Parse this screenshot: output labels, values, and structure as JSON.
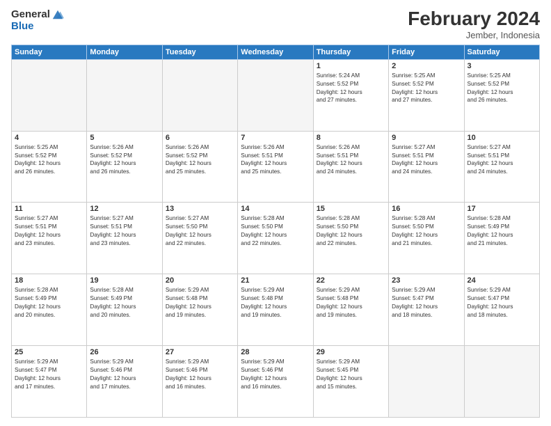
{
  "logo": {
    "general": "General",
    "blue": "Blue"
  },
  "header": {
    "month": "February 2024",
    "location": "Jember, Indonesia"
  },
  "weekdays": [
    "Sunday",
    "Monday",
    "Tuesday",
    "Wednesday",
    "Thursday",
    "Friday",
    "Saturday"
  ],
  "weeks": [
    [
      {
        "day": "",
        "info": ""
      },
      {
        "day": "",
        "info": ""
      },
      {
        "day": "",
        "info": ""
      },
      {
        "day": "",
        "info": ""
      },
      {
        "day": "1",
        "info": "Sunrise: 5:24 AM\nSunset: 5:52 PM\nDaylight: 12 hours\nand 27 minutes."
      },
      {
        "day": "2",
        "info": "Sunrise: 5:25 AM\nSunset: 5:52 PM\nDaylight: 12 hours\nand 27 minutes."
      },
      {
        "day": "3",
        "info": "Sunrise: 5:25 AM\nSunset: 5:52 PM\nDaylight: 12 hours\nand 26 minutes."
      }
    ],
    [
      {
        "day": "4",
        "info": "Sunrise: 5:25 AM\nSunset: 5:52 PM\nDaylight: 12 hours\nand 26 minutes."
      },
      {
        "day": "5",
        "info": "Sunrise: 5:26 AM\nSunset: 5:52 PM\nDaylight: 12 hours\nand 26 minutes."
      },
      {
        "day": "6",
        "info": "Sunrise: 5:26 AM\nSunset: 5:52 PM\nDaylight: 12 hours\nand 25 minutes."
      },
      {
        "day": "7",
        "info": "Sunrise: 5:26 AM\nSunset: 5:51 PM\nDaylight: 12 hours\nand 25 minutes."
      },
      {
        "day": "8",
        "info": "Sunrise: 5:26 AM\nSunset: 5:51 PM\nDaylight: 12 hours\nand 24 minutes."
      },
      {
        "day": "9",
        "info": "Sunrise: 5:27 AM\nSunset: 5:51 PM\nDaylight: 12 hours\nand 24 minutes."
      },
      {
        "day": "10",
        "info": "Sunrise: 5:27 AM\nSunset: 5:51 PM\nDaylight: 12 hours\nand 24 minutes."
      }
    ],
    [
      {
        "day": "11",
        "info": "Sunrise: 5:27 AM\nSunset: 5:51 PM\nDaylight: 12 hours\nand 23 minutes."
      },
      {
        "day": "12",
        "info": "Sunrise: 5:27 AM\nSunset: 5:51 PM\nDaylight: 12 hours\nand 23 minutes."
      },
      {
        "day": "13",
        "info": "Sunrise: 5:27 AM\nSunset: 5:50 PM\nDaylight: 12 hours\nand 22 minutes."
      },
      {
        "day": "14",
        "info": "Sunrise: 5:28 AM\nSunset: 5:50 PM\nDaylight: 12 hours\nand 22 minutes."
      },
      {
        "day": "15",
        "info": "Sunrise: 5:28 AM\nSunset: 5:50 PM\nDaylight: 12 hours\nand 22 minutes."
      },
      {
        "day": "16",
        "info": "Sunrise: 5:28 AM\nSunset: 5:50 PM\nDaylight: 12 hours\nand 21 minutes."
      },
      {
        "day": "17",
        "info": "Sunrise: 5:28 AM\nSunset: 5:49 PM\nDaylight: 12 hours\nand 21 minutes."
      }
    ],
    [
      {
        "day": "18",
        "info": "Sunrise: 5:28 AM\nSunset: 5:49 PM\nDaylight: 12 hours\nand 20 minutes."
      },
      {
        "day": "19",
        "info": "Sunrise: 5:28 AM\nSunset: 5:49 PM\nDaylight: 12 hours\nand 20 minutes."
      },
      {
        "day": "20",
        "info": "Sunrise: 5:29 AM\nSunset: 5:48 PM\nDaylight: 12 hours\nand 19 minutes."
      },
      {
        "day": "21",
        "info": "Sunrise: 5:29 AM\nSunset: 5:48 PM\nDaylight: 12 hours\nand 19 minutes."
      },
      {
        "day": "22",
        "info": "Sunrise: 5:29 AM\nSunset: 5:48 PM\nDaylight: 12 hours\nand 19 minutes."
      },
      {
        "day": "23",
        "info": "Sunrise: 5:29 AM\nSunset: 5:47 PM\nDaylight: 12 hours\nand 18 minutes."
      },
      {
        "day": "24",
        "info": "Sunrise: 5:29 AM\nSunset: 5:47 PM\nDaylight: 12 hours\nand 18 minutes."
      }
    ],
    [
      {
        "day": "25",
        "info": "Sunrise: 5:29 AM\nSunset: 5:47 PM\nDaylight: 12 hours\nand 17 minutes."
      },
      {
        "day": "26",
        "info": "Sunrise: 5:29 AM\nSunset: 5:46 PM\nDaylight: 12 hours\nand 17 minutes."
      },
      {
        "day": "27",
        "info": "Sunrise: 5:29 AM\nSunset: 5:46 PM\nDaylight: 12 hours\nand 16 minutes."
      },
      {
        "day": "28",
        "info": "Sunrise: 5:29 AM\nSunset: 5:46 PM\nDaylight: 12 hours\nand 16 minutes."
      },
      {
        "day": "29",
        "info": "Sunrise: 5:29 AM\nSunset: 5:45 PM\nDaylight: 12 hours\nand 15 minutes."
      },
      {
        "day": "",
        "info": ""
      },
      {
        "day": "",
        "info": ""
      }
    ]
  ]
}
